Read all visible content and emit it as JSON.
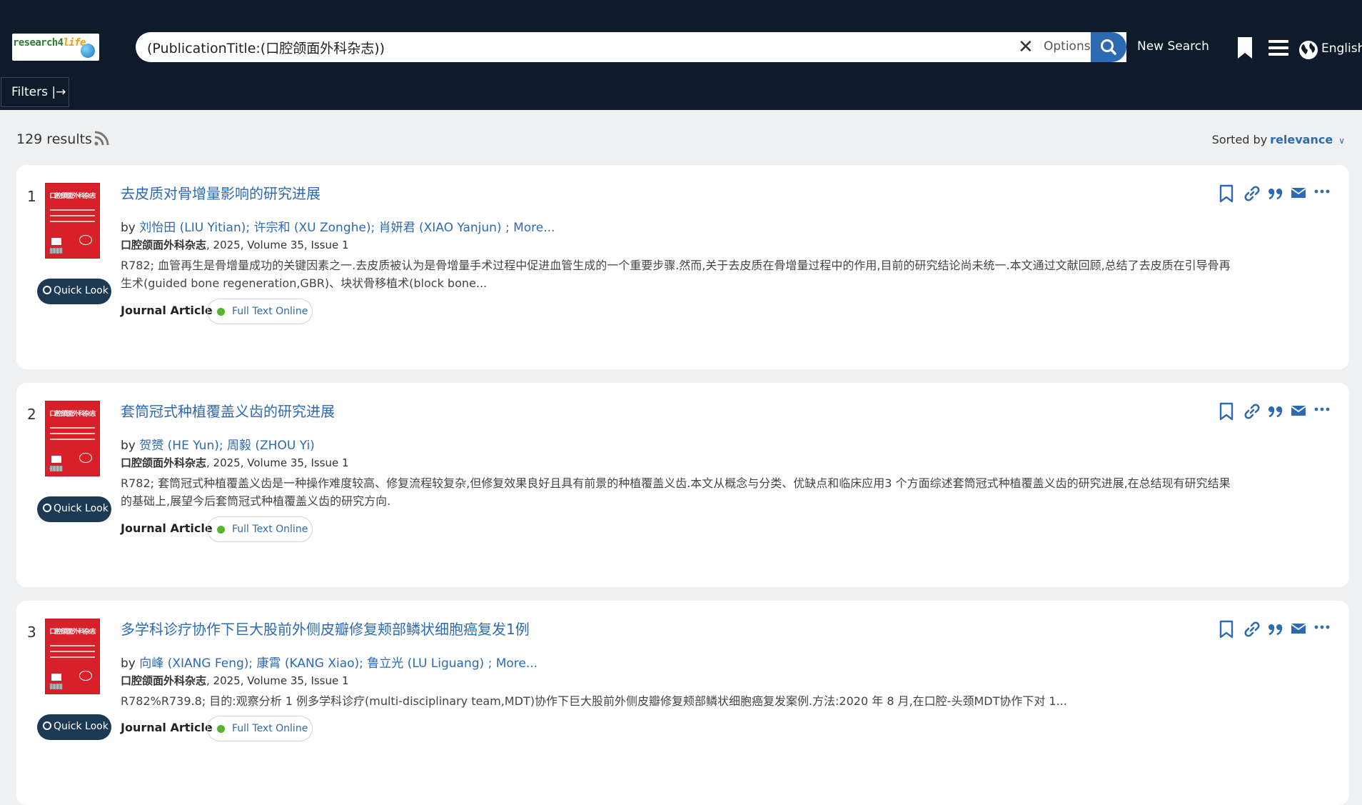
{
  "header": {
    "logo_text_a": "research4",
    "logo_text_b": "life",
    "search_value": "(PublicationTitle:(口腔颌面外科杂志))",
    "options_label": "Options",
    "new_search_label": "New Search",
    "language_label": "English",
    "filters_label": "Filters |→"
  },
  "results": {
    "count_label": "129 results",
    "sorted_by_label": "Sorted by",
    "sorted_value": "relevance"
  },
  "colors": {
    "header_bg": "#0f1b2a",
    "link": "#2d6ab1",
    "available_dot": "#55b42f"
  },
  "items": [
    {
      "number": "1",
      "title": "去皮质对骨增量影响的研究进展",
      "by": "by",
      "authors": "刘怡田 (LIU Yitian); 许宗和 (XU Zonghe); 肖妍君 (XIAO Yanjun) ; More...",
      "journal": "口腔颌面外科杂志",
      "meta": ", 2025, Volume 35, Issue 1",
      "abstract": "R782; 血管再生是骨增量成功的关键因素之一.去皮质被认为是骨增量手术过程中促进血管生成的一个重要步骤.然而,关于去皮质在骨增量过程中的作用,目前的研究结论尚未统一.本文通过文献回顾,总结了去皮质在引导骨再生术(guided bone regeneration,GBR)、块状骨移植术(block bone...",
      "type": "Journal Article",
      "availability": "Full Text Online",
      "quick_look": "Quick Look",
      "cover_title": "口腔颌面外科杂志"
    },
    {
      "number": "2",
      "title": "套筒冠式种植覆盖义齿的研究进展",
      "by": "by",
      "authors": "贺赟 (HE Yun); 周毅 (ZHOU Yi)",
      "journal": "口腔颌面外科杂志",
      "meta": ", 2025, Volume 35, Issue 1",
      "abstract": "R782; 套筒冠式种植覆盖义齿是一种操作难度较高、修复流程较复杂,但修复效果良好且具有前景的种植覆盖义齿.本文从概念与分类、优缺点和临床应用3 个方面综述套筒冠式种植覆盖义齿的研究进展,在总结现有研究结果的基础上,展望今后套筒冠式种植覆盖义齿的研究方向.",
      "type": "Journal Article",
      "availability": "Full Text Online",
      "quick_look": "Quick Look",
      "cover_title": "口腔颌面外科杂志"
    },
    {
      "number": "3",
      "title": "多学科诊疗协作下巨大股前外侧皮瓣修复颊部鳞状细胞癌复发1例",
      "by": "by",
      "authors": "向峰 (XIANG Feng); 康霄 (KANG Xiao); 鲁立光 (LU Liguang) ; More...",
      "journal": "口腔颌面外科杂志",
      "meta": ", 2025, Volume 35, Issue 1",
      "abstract": "R782%R739.8; 目的:观察分析 1 例多学科诊疗(multi-disciplinary team,MDT)协作下巨大股前外侧皮瓣修复颊部鳞状细胞癌复发案例.方法:2020 年 8 月,在口腔-头颈MDT协作下对 1...",
      "type": "Journal Article",
      "availability": "Full Text Online",
      "quick_look": "Quick Look",
      "cover_title": "口腔颌面外科杂志"
    }
  ]
}
